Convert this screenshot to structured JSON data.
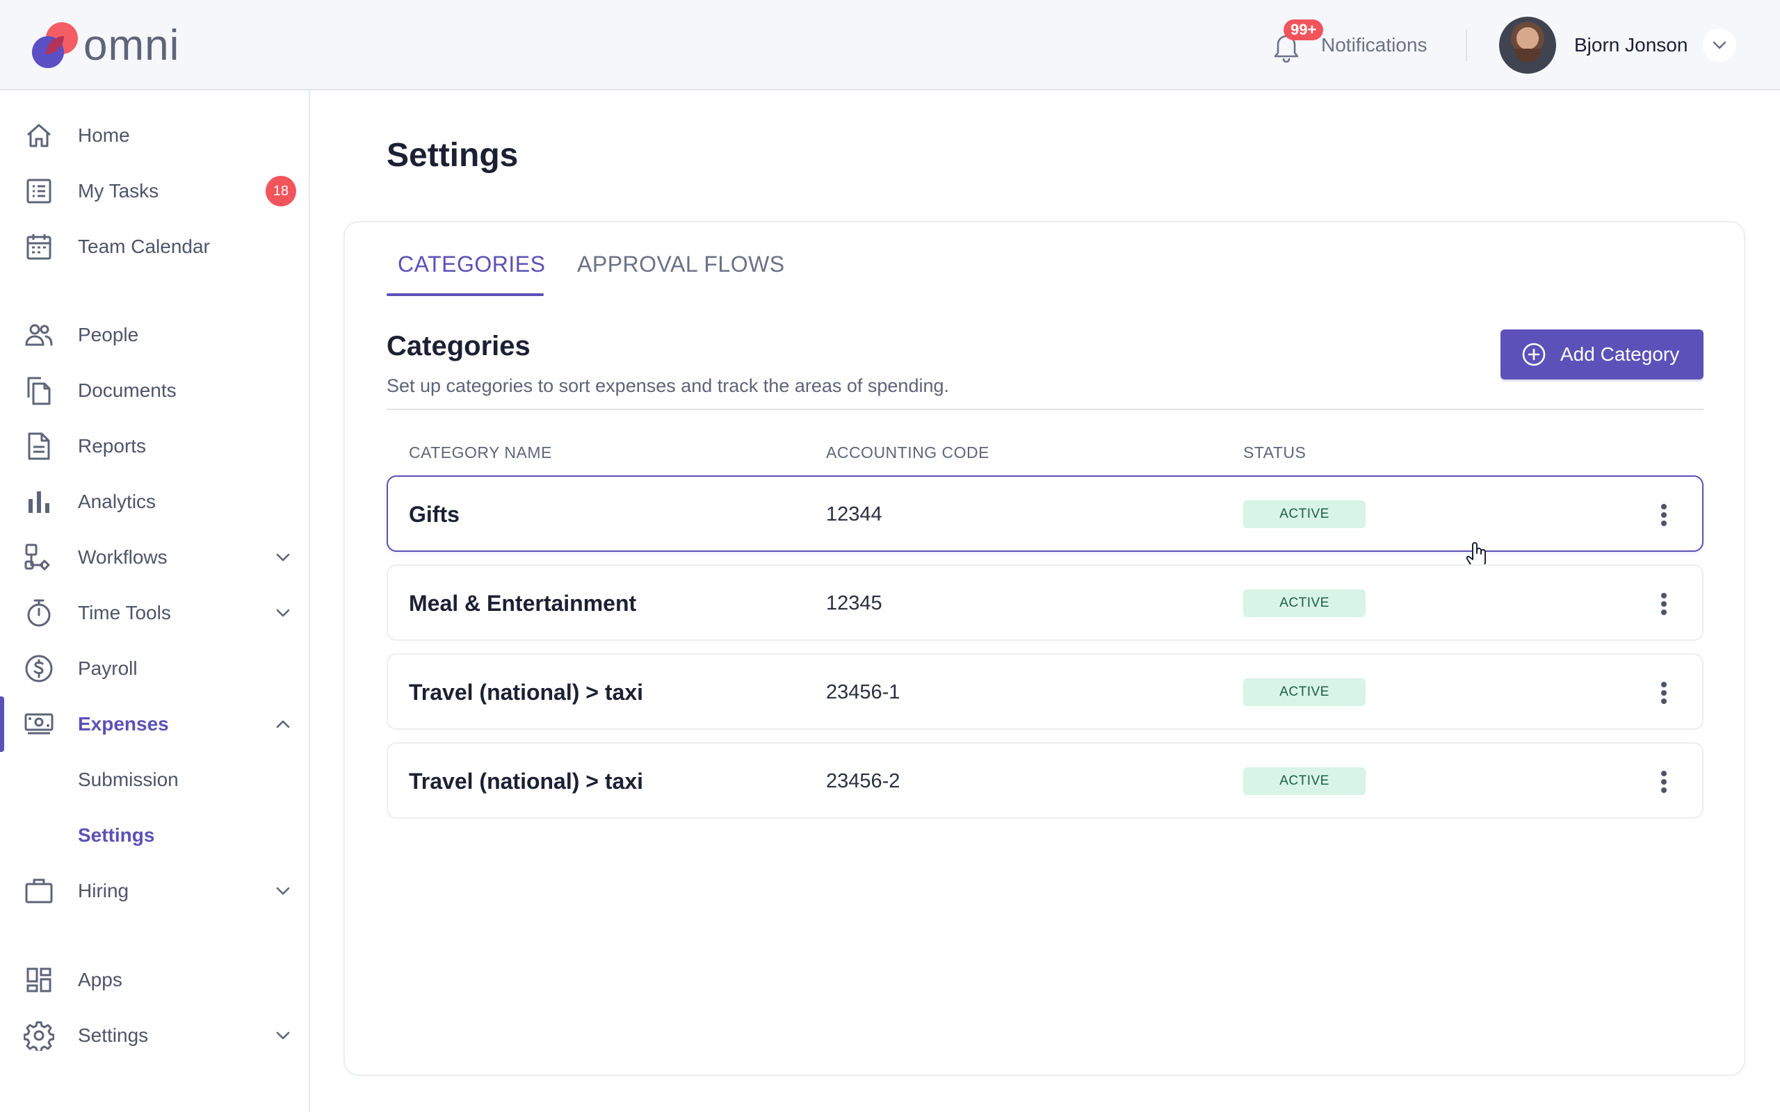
{
  "app": {
    "logo_text": "omni"
  },
  "header": {
    "notifications_badge": "99+",
    "notifications_label": "Notifications",
    "user_name": "Bjorn Jonson"
  },
  "sidebar": {
    "items": [
      {
        "label": "Home",
        "icon": "home-icon"
      },
      {
        "label": "My Tasks",
        "icon": "tasks-icon",
        "count": "18"
      },
      {
        "label": "Team Calendar",
        "icon": "calendar-icon"
      },
      {
        "label": "People",
        "icon": "people-icon"
      },
      {
        "label": "Documents",
        "icon": "documents-icon"
      },
      {
        "label": "Reports",
        "icon": "reports-icon"
      },
      {
        "label": "Analytics",
        "icon": "analytics-icon"
      },
      {
        "label": "Workflows",
        "icon": "workflows-icon"
      },
      {
        "label": "Time Tools",
        "icon": "stopwatch-icon"
      },
      {
        "label": "Payroll",
        "icon": "dollar-icon"
      },
      {
        "label": "Expenses",
        "icon": "money-icon"
      },
      {
        "label": "Hiring",
        "icon": "briefcase-icon"
      },
      {
        "label": "Apps",
        "icon": "apps-icon"
      },
      {
        "label": "Settings",
        "icon": "gear-icon"
      }
    ],
    "expenses_sub": [
      "Submission",
      "Settings"
    ]
  },
  "page": {
    "title": "Settings",
    "tabs": [
      "CATEGORIES",
      "APPROVAL FLOWS"
    ],
    "section_title": "Categories",
    "section_subtitle": "Set up categories to sort expenses and track the areas of spending.",
    "add_button": "Add Category"
  },
  "table": {
    "columns": [
      "CATEGORY NAME",
      "ACCOUNTING CODE",
      "STATUS"
    ],
    "rows": [
      {
        "name": "Gifts",
        "code": "12344",
        "status": "ACTIVE"
      },
      {
        "name": "Meal & Entertainment",
        "code": "12345",
        "status": "ACTIVE"
      },
      {
        "name": "Travel (national) > taxi",
        "code": "23456-1",
        "status": "ACTIVE"
      },
      {
        "name": "Travel (national) > taxi",
        "code": "23456-2",
        "status": "ACTIVE"
      }
    ]
  },
  "colors": {
    "accent": "#5b51b8",
    "badge_red": "#f2545b",
    "status_bg": "#d7f4e6",
    "status_text": "#1d5e45"
  }
}
